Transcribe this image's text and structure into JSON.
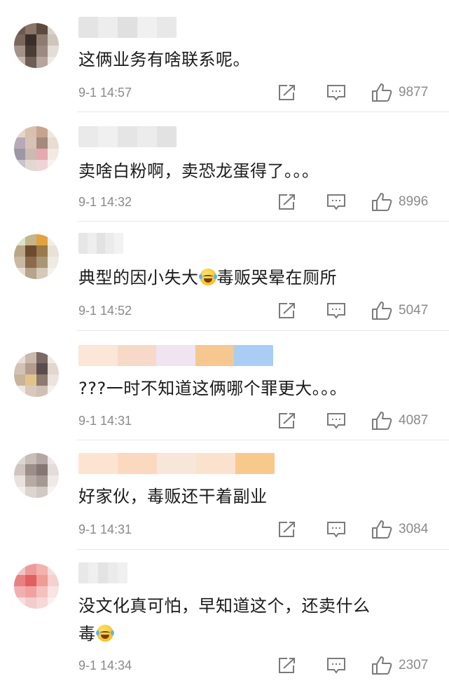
{
  "comments": [
    {
      "text": "这俩业务有啥联系呢。",
      "time": "9-1 14:57",
      "likes": "9877",
      "avatar_colors": [
        "#6b5a4e",
        "#8a7566",
        "#5c4a3f",
        "#d9d1cb",
        "#7b665a",
        "#3a2f28",
        "#8f7c70",
        "#cfc5bd",
        "#a3928a",
        "#4a3d35",
        "#9c8a80",
        "#e3dcd7",
        "#c2b6ad",
        "#6e5e55",
        "#b5a59c",
        "#eeeae6"
      ],
      "name_colors": [
        "#e4e4e4",
        "#ededed",
        "#e0e0e0",
        "#f0f0f0",
        "#e8e8e8"
      ]
    },
    {
      "text": "卖啥白粉啊，卖恐龙蛋得了。。。",
      "time": "9-1 14:32",
      "likes": "8996",
      "avatar_colors": [
        "#e6d4c6",
        "#d8bfae",
        "#c7a48e",
        "#f0e6de",
        "#b7a9b8",
        "#d6c3b5",
        "#a48a7c",
        "#e9dcd3",
        "#9d96a8",
        "#cbbab0",
        "#e7a9b0",
        "#f2e9e4",
        "#c8c3cc",
        "#e1d8d2",
        "#eed4d8",
        "#f7f2ef"
      ],
      "name_colors": [
        "#eaeaea",
        "#f0f0f0",
        "#e5e5e5",
        "#ececec",
        "#e2e2e2"
      ]
    },
    {
      "text_before": "典型的因小失大",
      "text_after": "毒贩哭晕在厕所",
      "time": "9-1 14:52",
      "likes": "5047",
      "avatar_colors": [
        "#d9e3c6",
        "#c4b68c",
        "#e3a23c",
        "#f1ede2",
        "#b8a58a",
        "#6d4b2e",
        "#9a7a4c",
        "#e8e2d6",
        "#c9b9a1",
        "#8c6b4a",
        "#a89676",
        "#efeae2",
        "#e6ddd0",
        "#b6a48c",
        "#d5c9b8",
        "#f5f1ec"
      ],
      "name_colors": [
        "#e6e6e6",
        "#eeeeee",
        "#e2e2e2",
        "#ebebeb",
        "#f2f2f2"
      ]
    },
    {
      "text": "???一时不知道这俩哪个罪更大。。。",
      "time": "9-1 14:31",
      "likes": "4087",
      "avatar_colors": [
        "#e8ddd6",
        "#c9b8ae",
        "#7a6a66",
        "#efe8e4",
        "#d2c2b6",
        "#b49c8c",
        "#5b4d4d",
        "#e2d6ce",
        "#c8b49a",
        "#e2c48a",
        "#8d7a70",
        "#ebe3dd",
        "#efe6e0",
        "#d9c9bc",
        "#cfc0b4",
        "#f5f0ec"
      ],
      "name_colors": [
        "#fbe6d8",
        "#f6d9c6",
        "#efe4f0",
        "#f6c88f",
        "#a9cdf5"
      ]
    },
    {
      "text": "好家伙，毒贩还干着副业",
      "time": "9-1 14:31",
      "likes": "3084",
      "avatar_colors": [
        "#ddd6d2",
        "#c8bdb8",
        "#b3a7a3",
        "#ece7e4",
        "#cfc4bf",
        "#9c8f8a",
        "#857873",
        "#e3dcd8",
        "#e8e1dd",
        "#b7aba6",
        "#a59994",
        "#efeae7",
        "#f2eeeb",
        "#ddd4cf",
        "#d2c8c3",
        "#f7f4f2"
      ],
      "name_colors": [
        "#fde4d2",
        "#fbd9c0",
        "#f8e6da",
        "#fae2cf",
        "#f7c98c"
      ]
    },
    {
      "text_line1": "没文化真可怕，早知道这个，还卖什么",
      "text_line2_before": "毒",
      "time": "9-1 14:34",
      "likes": "2307",
      "avatar_colors": [
        "#f3c3c3",
        "#ee9a9a",
        "#f2b2ad",
        "#f7dcdc",
        "#e98080",
        "#e35f5f",
        "#ef9c94",
        "#f6d0cf",
        "#f1b0b0",
        "#f0a39e",
        "#f4c2be",
        "#f9e4e3",
        "#f8dddd",
        "#f4cccc",
        "#f6d8d6",
        "#fbeeee"
      ],
      "name_colors": [
        "#e8e8e8",
        "#efefef",
        "#e3e3e3",
        "#ebebeb",
        "#f0f0f0"
      ]
    }
  ],
  "icons": {
    "share": "share-icon",
    "reply": "comment-icon",
    "like": "thumbs-up-icon",
    "emoji_laugh_cry": "laugh-cry-emoji-icon",
    "emoji_grin_sweat": "grin-sweat-emoji-icon"
  },
  "colors": {
    "text": "#1a1a1a",
    "meta": "#8a8a8a",
    "divider": "#e6e6e6"
  }
}
